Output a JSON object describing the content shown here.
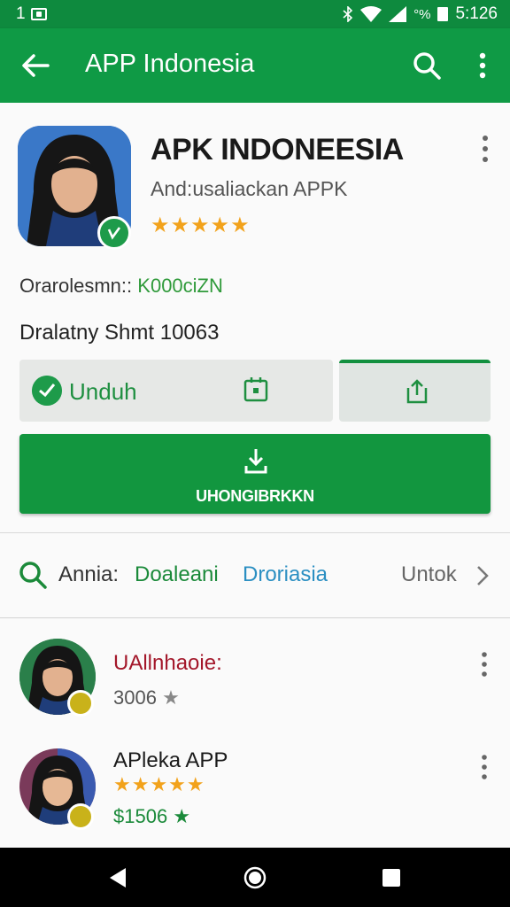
{
  "status_bar": {
    "left_text": "1",
    "battery_text": "°%",
    "time": "5:126"
  },
  "app_bar": {
    "title": "APP Indonesia"
  },
  "app": {
    "title": "APK INDONEESIA",
    "subtitle": "And:usaliackan APPK",
    "rating_stars": "★★★★★",
    "rating_value": 4.5,
    "meta_label": "Orarolesmn::",
    "meta_value": "K000ciZN",
    "meta2": "Dralatny Shmt 10063"
  },
  "actions": {
    "unduh_label": "Unduh",
    "install_label": "UHONGIBRKKN"
  },
  "search_row": {
    "prefix": "Annia:",
    "term1": "Doaleani",
    "term2": "Droriasia",
    "more": "Untok"
  },
  "list": [
    {
      "name": "UAllnhaoie:",
      "sub": "3006",
      "sub_star": "★",
      "name_color": "#a3172a",
      "sub_color": "#555555",
      "badge_color": "#c9b21a"
    },
    {
      "name": "APleka APP",
      "stars": "★★★★★",
      "sub": "$1506",
      "sub_star": "★",
      "name_color": "#1a1a1a",
      "sub_color": "#1b8a3a",
      "badge_color": "#c9b21a"
    }
  ],
  "colors": {
    "brand_green": "#0f9a45",
    "status_green": "#0e8a3e",
    "star_orange": "#f2a21b"
  },
  "icons": [
    "back-arrow-icon",
    "search-icon",
    "more-vert-icon",
    "chat-icon",
    "calendar-icon",
    "share-icon",
    "download-icon",
    "chevron-right-icon",
    "nav-back-icon",
    "nav-home-icon",
    "nav-recents-icon"
  ]
}
